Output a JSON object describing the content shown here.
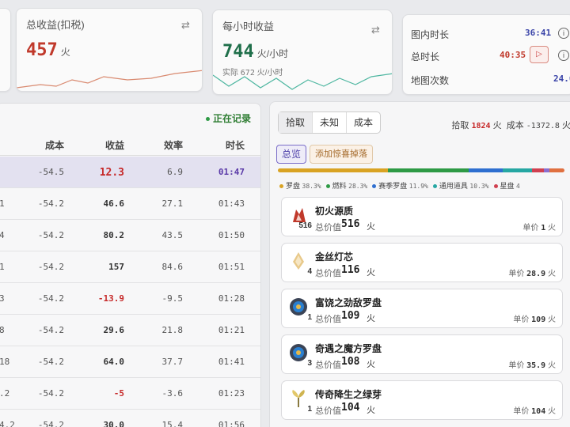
{
  "stats": {
    "total": {
      "title": "总收益(扣税)",
      "value": "457",
      "unit": "火"
    },
    "hourly": {
      "title": "每小时收益",
      "value": "744",
      "unit": "火/小时",
      "actual_label": "实际",
      "actual_value": "672",
      "actual_unit": "火/小时"
    },
    "time": {
      "map_time_label": "图内时长",
      "map_time": "36:41",
      "total_time_label": "总时长",
      "total_time": "40:35",
      "map_count_label": "地图次数",
      "map_count": "24.0"
    }
  },
  "records": {
    "status": "正在记录",
    "headers": [
      "成本",
      "收益",
      "效率",
      "时长"
    ],
    "rows": [
      {
        "idx": "",
        "cost": "-54.5",
        "profit": "12.3",
        "eff": "6.9",
        "dur": "01:47",
        "active": true
      },
      {
        "idx": "1",
        "cost": "-54.2",
        "profit": "46.6",
        "eff": "27.1",
        "dur": "01:43"
      },
      {
        "idx": "4",
        "cost": "-54.2",
        "profit": "80.2",
        "eff": "43.5",
        "dur": "01:50"
      },
      {
        "idx": "1",
        "cost": "-54.2",
        "profit": "157",
        "eff": "84.6",
        "dur": "01:51"
      },
      {
        "idx": "3",
        "cost": "-54.2",
        "profit": "-13.9",
        "eff": "-9.5",
        "dur": "01:28"
      },
      {
        "idx": "8",
        "cost": "-54.2",
        "profit": "29.6",
        "eff": "21.8",
        "dur": "01:21"
      },
      {
        "idx": "18",
        "cost": "-54.2",
        "profit": "64.0",
        "eff": "37.7",
        "dur": "01:41"
      },
      {
        "idx": ".2",
        "cost": "-54.2",
        "profit": "-5",
        "eff": "-3.6",
        "dur": "01:23"
      },
      {
        "idx": "4.2",
        "cost": "-54.2",
        "profit": "30.0",
        "eff": "15.4",
        "dur": "01:56"
      }
    ]
  },
  "loot": {
    "tabs": [
      "拾取",
      "未知",
      "成本"
    ],
    "summary": {
      "pickup_label": "拾取",
      "pickup_value": "1824",
      "pickup_unit": "火",
      "cost_label": "成本",
      "cost_value": "-1372.8",
      "cost_unit": "火"
    },
    "overview_button": "总览",
    "add_button": "添加惊喜掉落",
    "categories": [
      {
        "name": "罗盘",
        "pct": "38.3%",
        "color": "#d9a323",
        "frac": 0.383
      },
      {
        "name": "燃料",
        "pct": "28.3%",
        "color": "#2e9a45",
        "frac": 0.283
      },
      {
        "name": "赛季罗盘",
        "pct": "11.9%",
        "color": "#2f6fd0",
        "frac": 0.119
      },
      {
        "name": "通用道具",
        "pct": "10.3%",
        "color": "#26a7a3",
        "frac": 0.103
      },
      {
        "name": "星盘",
        "pct": "4",
        "color": "#d04050",
        "frac": 0.04
      },
      {
        "name": "",
        "pct": "",
        "color": "#8a6fd0",
        "frac": 0.02
      },
      {
        "name": "",
        "pct": "",
        "color": "#e07040",
        "frac": 0.052
      }
    ],
    "items": [
      {
        "name": "初火源质",
        "count": "516",
        "total_label": "总价值",
        "total": "516",
        "unit": "火",
        "price_label": "单价",
        "price": "1",
        "price_unit": "火"
      },
      {
        "name": "金丝灯芯",
        "count": "4",
        "total_label": "总价值",
        "total": "116",
        "unit": "火",
        "price_label": "单价",
        "price": "28.9",
        "price_unit": "火"
      },
      {
        "name": "富饶之劲敌罗盘",
        "count": "1",
        "total_label": "总价值",
        "total": "109",
        "unit": "火",
        "price_label": "单价",
        "price": "109",
        "price_unit": "火"
      },
      {
        "name": "奇遇之魔方罗盘",
        "count": "3",
        "total_label": "总价值",
        "total": "108",
        "unit": "火",
        "price_label": "单价",
        "price": "35.9",
        "price_unit": "火"
      },
      {
        "name": "传奇降生之绿芽",
        "count": "1",
        "total_label": "总价值",
        "total": "104",
        "unit": "火",
        "price_label": "单价",
        "price": "104",
        "price_unit": "火"
      }
    ],
    "item_icons": [
      "flame-crystal-icon",
      "lamp-wick-icon",
      "compass-icon",
      "compass-icon",
      "sprout-icon"
    ]
  }
}
